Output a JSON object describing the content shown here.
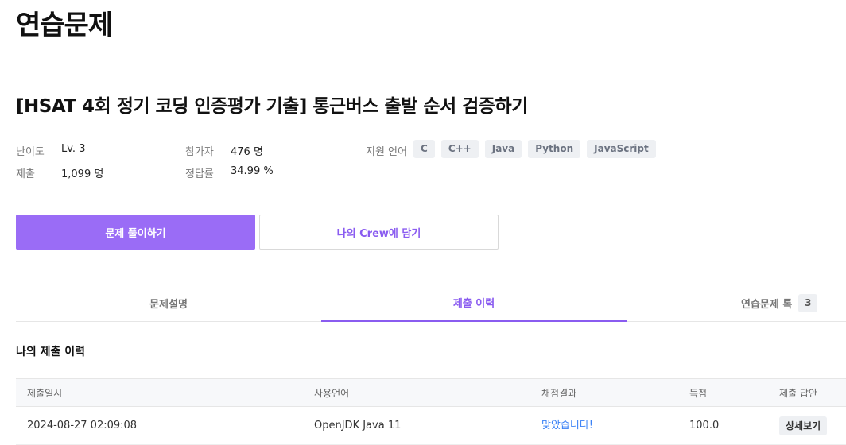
{
  "page": {
    "heading": "연습문제"
  },
  "problem": {
    "title": "[HSAT 4회 정기 코딩 인증평가 기출] 통근버스 출발 순서 검증하기",
    "stats": {
      "difficulty_label": "난이도",
      "difficulty_value": "Lv. 3",
      "participants_label": "참가자",
      "participants_value": "476 명",
      "submissions_label": "제출",
      "submissions_value": "1,099 명",
      "accuracy_label": "정답률",
      "accuracy_value": "34.99 %"
    },
    "languages_label": "지원 언어",
    "languages": [
      "C",
      "C++",
      "Java",
      "Python",
      "JavaScript"
    ]
  },
  "actions": {
    "solve_label": "문제 풀이하기",
    "crew_label": "나의 Crew에 담기"
  },
  "tabs": [
    {
      "label": "문제설명"
    },
    {
      "label": "제출 이력"
    },
    {
      "label": "연습문제 톡",
      "count": "3"
    }
  ],
  "active_tab": "제출 이력",
  "history": {
    "title": "나의 제출 이력",
    "columns": [
      "제출일시",
      "사용언어",
      "채점결과",
      "득점",
      "제출 답안"
    ],
    "rows": [
      {
        "submitted_at": "2024-08-27 02:09:08",
        "language": "OpenJDK Java 11",
        "result": "맞았습니다!",
        "score": "100.0",
        "action": "상세보기"
      }
    ]
  },
  "colors": {
    "accent": "#9a6cf6",
    "accent_text": "#8a5cf0",
    "result_ok": "#3b82f6",
    "chip_bg": "#eef0f3"
  }
}
